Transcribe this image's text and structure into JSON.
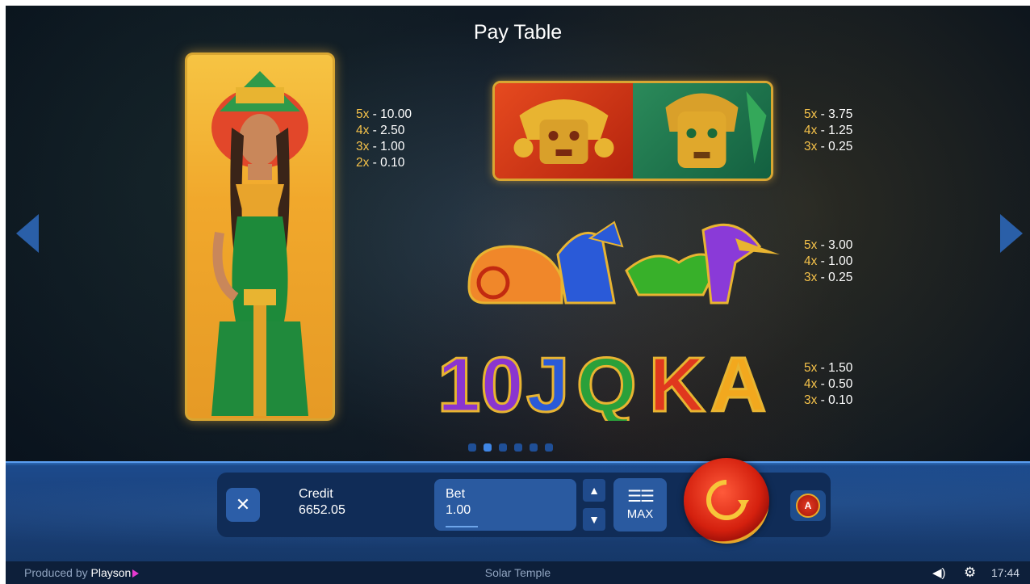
{
  "title": "Pay Table",
  "symbols": {
    "queen": {
      "pays": [
        {
          "k": "5x",
          "v": " - 10.00"
        },
        {
          "k": "4x",
          "v": " - 2.50"
        },
        {
          "k": "3x",
          "v": " - 1.00"
        },
        {
          "k": "2x",
          "v": " - 0.10"
        }
      ]
    },
    "masks": {
      "pays": [
        {
          "k": "5x",
          "v": " - 3.75"
        },
        {
          "k": "4x",
          "v": " - 1.25"
        },
        {
          "k": "3x",
          "v": " - 0.25"
        }
      ]
    },
    "animals": {
      "pays": [
        {
          "k": "5x",
          "v": " - 3.00"
        },
        {
          "k": "4x",
          "v": " - 1.00"
        },
        {
          "k": "3x",
          "v": " - 0.25"
        }
      ]
    },
    "royals": {
      "letters": [
        "10",
        "J",
        "Q",
        "K",
        "A"
      ],
      "pays": [
        {
          "k": "5x",
          "v": " - 1.50"
        },
        {
          "k": "4x",
          "v": " - 0.50"
        },
        {
          "k": "3x",
          "v": " - 0.10"
        }
      ]
    }
  },
  "pagination": {
    "pages": 6,
    "active_index": 1
  },
  "controls": {
    "credit_label": "Credit",
    "credit_value": "6652.05",
    "bet_label": "Bet",
    "bet_value": "1.00",
    "max_label": "MAX",
    "autoplay_label": "A"
  },
  "footer": {
    "produced_by": "Produced by ",
    "brand": "Playson",
    "game_name": "Solar Temple",
    "time": "17:44"
  },
  "icons": [
    "arrow-left-icon",
    "arrow-right-icon",
    "close-icon",
    "arrow-up-icon",
    "arrow-down-icon",
    "coins-icon",
    "spin-icon",
    "autoplay-icon",
    "sound-icon",
    "gear-icon"
  ]
}
